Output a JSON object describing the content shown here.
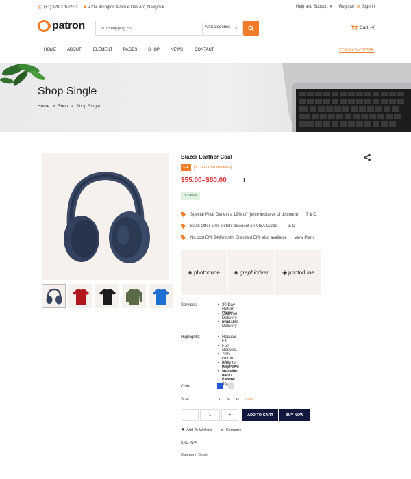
{
  "topbar": {
    "phone": "(+1) 828-376-0532",
    "address": "4214 Arlington Avenue Des Arc, Newyouk",
    "help": "Help and Support",
    "register": "Register",
    "or": "or",
    "signin": "Sign In"
  },
  "header": {
    "logo": "patron",
    "search_placeholder": "I'm Shopping For...",
    "category": "All Categories",
    "cart_label": "Cart",
    "cart_count": "(4)"
  },
  "nav": {
    "items": [
      "HOME",
      "ABOUT",
      "ELEMENT",
      "PAGES",
      "SHOP",
      "NEWS",
      "CONTACT"
    ],
    "offer": "TODAY'S OFFER"
  },
  "banner": {
    "title": "Shop Single",
    "breadcrumb": [
      "Home",
      "Shop",
      "Shop Single"
    ],
    "separator": ">"
  },
  "product": {
    "title": "Blazer Leather Coat",
    "rating": "5 ★",
    "reviews": "(2 customer reviews)",
    "price": "$55.00–$80.00",
    "price_note": "!",
    "stock": "In Stock",
    "offers": [
      {
        "text": "Special Price Get extra 19% off (price inclusive of discount)",
        "link": "T & C"
      },
      {
        "text": "Bank Offer 10% instant discount on VISA Cards",
        "link": "T & C"
      },
      {
        "text": "No cost EMI $49/month. Standard EMI also available",
        "link": "View Plans"
      }
    ],
    "brands": [
      "photodune",
      "graphicriver",
      "photodune"
    ],
    "services_label": "Services:",
    "services": [
      "30 Day Return Policy",
      "Cash on Delivery available",
      "Free Delivery"
    ],
    "highlights_label": "Highlights:",
    "highlights": [
      "Regular Fit.",
      "Full sleeves.",
      "70% cotton, 30% polyester.",
      "Easy to wear and versatile as Casual.",
      "Machine wash, tumble dry."
    ],
    "color_label": "Color",
    "colors": [
      "#2456d8",
      "#dcdcdc"
    ],
    "size_label": "Size",
    "sizes": [
      "L",
      "M",
      "XL"
    ],
    "clear": "Clear",
    "qty_minus": "-",
    "qty_value": "1",
    "qty_plus": "+",
    "add_to_cart": "ADD TO CART",
    "buy_now": "BUY NOW",
    "wishlist": "Add To Wishlist",
    "compare": "Compare",
    "sku_label": "SKU:",
    "sku": "N/A",
    "category_label": "Category:",
    "category": "Blazer"
  },
  "thumbnails": [
    "headphones",
    "red-shirt",
    "black-shirt",
    "olive-shirt",
    "blue-shirt"
  ],
  "colors": {
    "accent": "#f07c2a",
    "price": "#d9343a",
    "dark_button": "#11173d",
    "stock_bg": "#e3f1e4"
  }
}
